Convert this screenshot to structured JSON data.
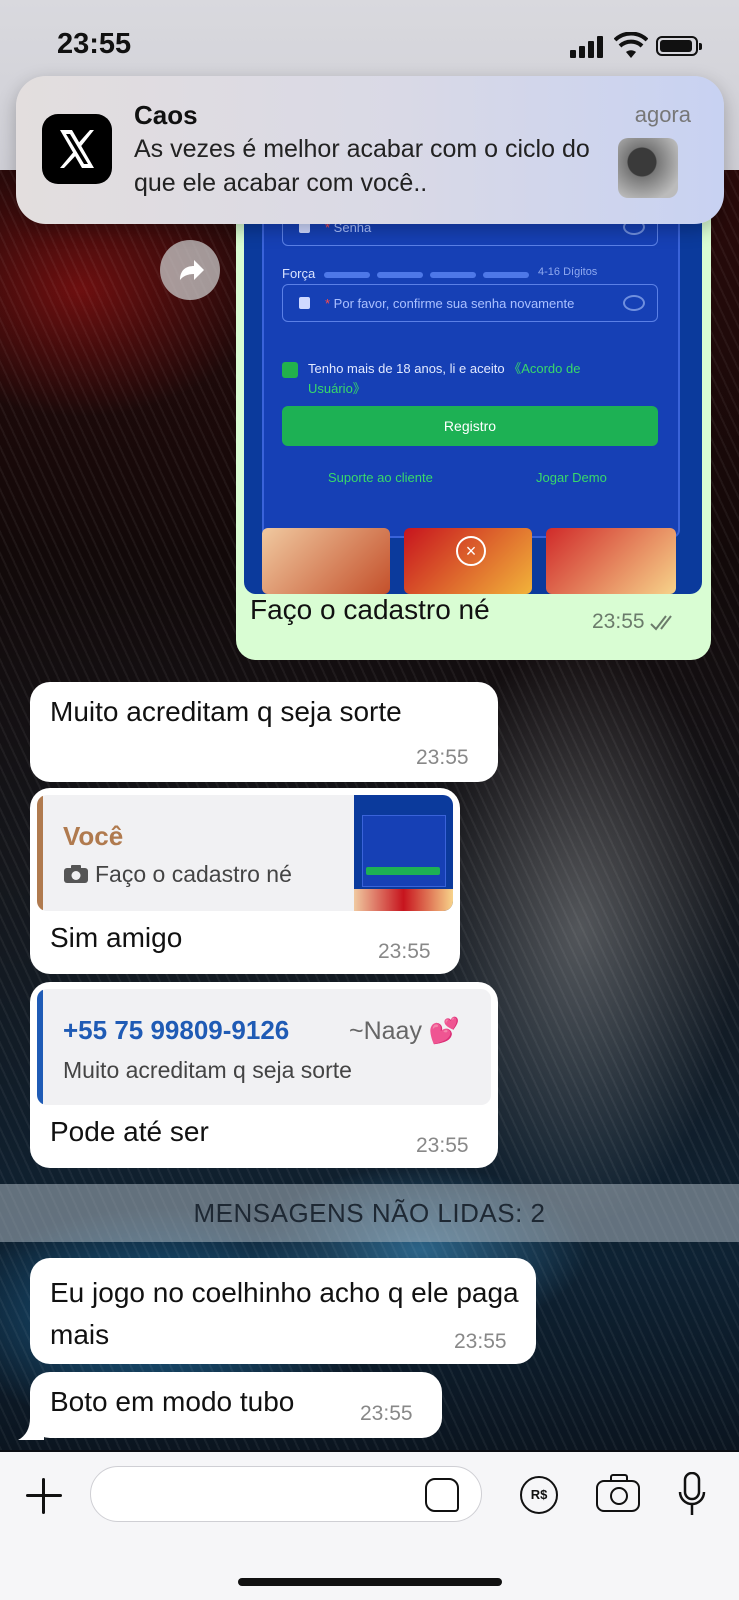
{
  "status_bar": {
    "time": "23:55"
  },
  "notification": {
    "app_icon": "x-logo-icon",
    "title": "Caos",
    "time": "agora",
    "body": "As vezes é melhor acabar com o ciclo do que ele acabar com você.."
  },
  "screenshot_preview": {
    "password_placeholder": "Senha",
    "strength_label": "Força",
    "strength_hint": "4-16 Dígitos",
    "confirm_placeholder": "Por favor, confirme sua senha novamente",
    "accept_text": "Tenho mais de 18 anos, li e aceito",
    "accept_link": "《Acordo de Usuário》",
    "register_button": "Registro",
    "support_link": "Suporte ao cliente",
    "demo_link": "Jogar Demo"
  },
  "messages": [
    {
      "type": "outgoing_image",
      "caption": "Faço o cadastro né",
      "time": "23:55",
      "status": "read"
    },
    {
      "type": "incoming",
      "text": "Muito acreditam q seja sorte",
      "time": "23:55"
    },
    {
      "type": "incoming_reply",
      "quoted_name": "Você",
      "quoted_text": "Faço o cadastro né",
      "text": "Sim amigo",
      "time": "23:55"
    },
    {
      "type": "incoming_reply",
      "quoted_name": "+55 75 99809-9126",
      "quoted_alias": "~Naay 💕",
      "quoted_text": "Muito acreditam q seja sorte",
      "text": "Pode até ser",
      "time": "23:55"
    },
    {
      "type": "incoming",
      "text": "Eu jogo no coelhinho acho q ele paga mais",
      "time": "23:55"
    },
    {
      "type": "incoming",
      "text": "Boto em modo tubo",
      "time": "23:55"
    }
  ],
  "unread_divider": "MENSAGENS NÃO LIDAS: 2",
  "composer": {
    "value": ""
  },
  "colors": {
    "outgoing_bubble": "#d9fdd3",
    "incoming_bubble": "#ffffff",
    "quote_you": "#b07a4e",
    "quote_other": "#1f5bb5"
  }
}
